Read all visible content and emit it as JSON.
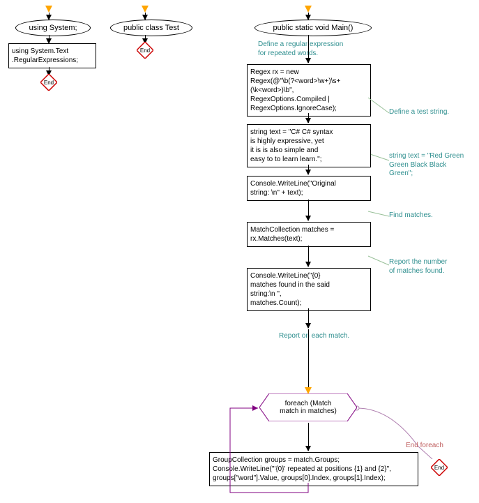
{
  "col1": {
    "ellipse": "using System;",
    "box": "using System.Text\n.RegularExpressions;",
    "end": "End"
  },
  "col2": {
    "ellipse": "public class Test",
    "end": "End"
  },
  "col3": {
    "ellipse": "public static void Main()",
    "ann1": "Define a regular expression\nfor repeated words.",
    "box1": "Regex rx = new\nRegex(@\"\\b(?<word>\\w+)\\s+\n(\\k<word>)\\b\",\nRegexOptions.Compiled |\nRegexOptions.IgnoreCase);",
    "ann2": "Define a test string.",
    "box2": "string text = \"C# C# syntax\nis highly expressive, yet\nit is is also simple and\neasy to to learn learn.\";",
    "ann3": "string text = \"Red Green\nGreen Black Black\nGreen\";",
    "box3": "Console.WriteLine(\"Original\nstring: \\n\" + text);",
    "ann4": "Find matches.",
    "box4": "MatchCollection matches =\nrx.Matches(text);",
    "ann5": "Report the number\nof matches found.",
    "box5": "Console.WriteLine(\"{0}\nmatches found in the said\nstring:\\n   \",\nmatches.Count);",
    "ann6": "Report on each match.",
    "hex": "foreach (Match\nmatch in matches)",
    "ann7": "End foreach",
    "box6": "GroupCollection groups = match.Groups;\nConsole.WriteLine(\"'{0}' repeated at positions {1} and {2}\",\ngroups[\"word\"].Value, groups[0].Index, groups[1].Index);",
    "end": "End"
  }
}
